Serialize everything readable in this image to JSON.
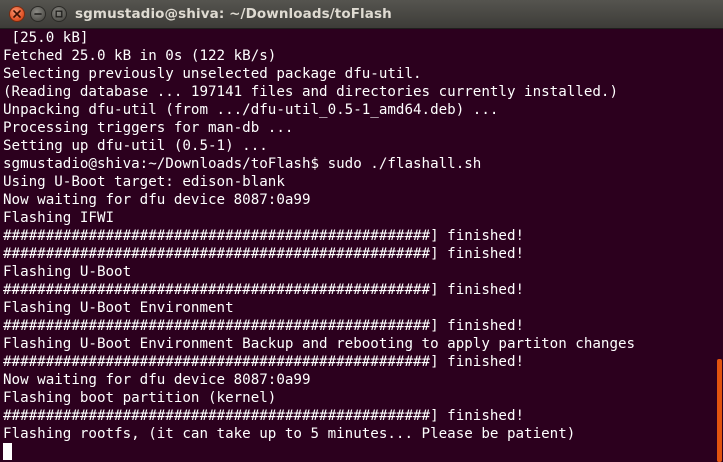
{
  "window": {
    "title": "sgmustadio@shiva: ~/Downloads/toFlash",
    "buttons": [
      {
        "name": "close",
        "icon": "close-icon"
      },
      {
        "name": "minimize",
        "icon": "minimize-icon"
      },
      {
        "name": "maximize",
        "icon": "maximize-icon"
      }
    ]
  },
  "colors": {
    "background": "#2c001e",
    "text": "#ffffff",
    "close_button": "#e2572b",
    "scrollbar_thumb": "#e1530f"
  },
  "terminal": {
    "lines": [
      " [25.0 kB]",
      "Fetched 25.0 kB in 0s (122 kB/s)",
      "Selecting previously unselected package dfu-util.",
      "(Reading database ... 197141 files and directories currently installed.)",
      "Unpacking dfu-util (from .../dfu-util_0.5-1_amd64.deb) ...",
      "Processing triggers for man-db ...",
      "Setting up dfu-util (0.5-1) ...",
      "sgmustadio@shiva:~/Downloads/toFlash$ sudo ./flashall.sh",
      "Using U-Boot target: edison-blank",
      "Now waiting for dfu device 8087:0a99",
      "Flashing IFWI",
      "##################################################] finished!",
      "##################################################] finished!",
      "Flashing U-Boot",
      "##################################################] finished!",
      "Flashing U-Boot Environment",
      "##################################################] finished!",
      "Flashing U-Boot Environment Backup and rebooting to apply partiton changes",
      "##################################################] finished!",
      "Now waiting for dfu device 8087:0a99",
      "Flashing boot partition (kernel)",
      "##################################################] finished!",
      "Flashing rootfs, (it can take up to 5 minutes... Please be patient)"
    ]
  }
}
